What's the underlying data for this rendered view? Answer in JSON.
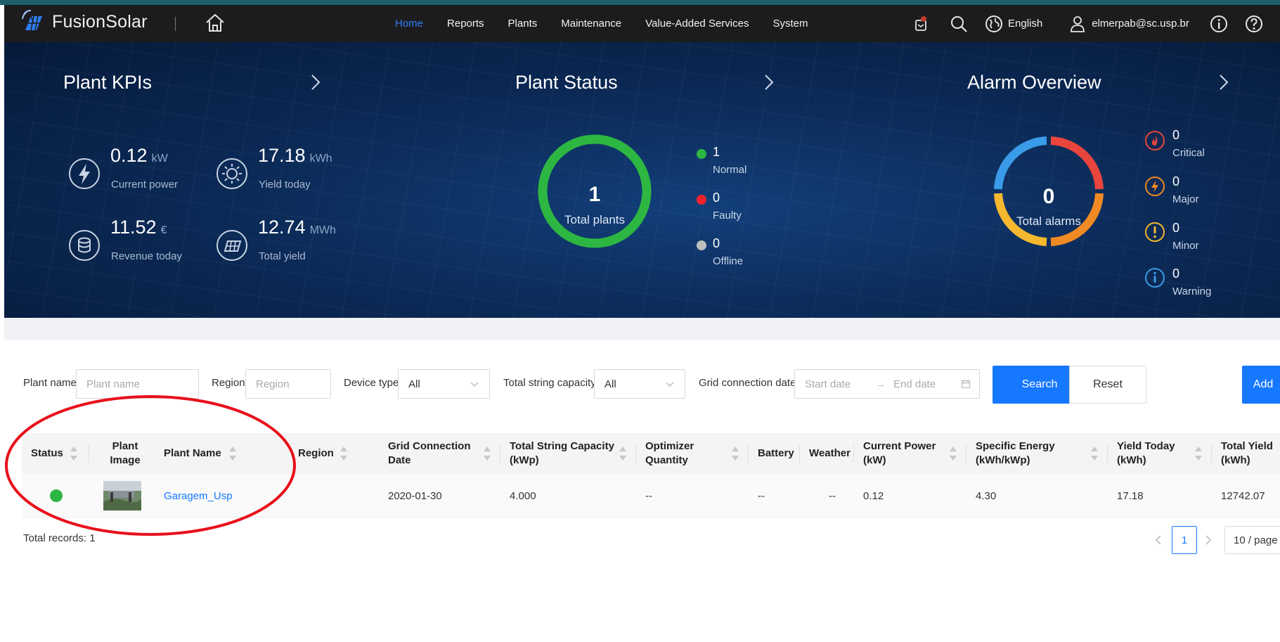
{
  "app": {
    "name": "FusionSolar"
  },
  "nav": {
    "items": [
      {
        "label": "Home",
        "active": true
      },
      {
        "label": "Reports"
      },
      {
        "label": "Plants"
      },
      {
        "label": "Maintenance"
      },
      {
        "label": "Value-Added Services"
      },
      {
        "label": "System"
      }
    ]
  },
  "header_tools": {
    "language": "English",
    "user": "elmerpab@sc.usp.br"
  },
  "kpis": {
    "title": "Plant KPIs",
    "current_power": {
      "value": "0.12",
      "unit": "kW",
      "label": "Current power"
    },
    "yield_today": {
      "value": "17.18",
      "unit": "kWh",
      "label": "Yield today"
    },
    "revenue_today": {
      "value": "11.52",
      "unit": "€",
      "label": "Revenue today"
    },
    "total_yield": {
      "value": "12.74",
      "unit": "MWh",
      "label": "Total yield"
    }
  },
  "plant_status": {
    "title": "Plant Status",
    "total": "1",
    "total_label": "Total plants",
    "normal": {
      "count": "1",
      "label": "Normal",
      "color": "#2db742"
    },
    "faulty": {
      "count": "0",
      "label": "Faulty",
      "color": "#f5222d"
    },
    "offline": {
      "count": "0",
      "label": "Offline",
      "color": "#bfbfbf"
    }
  },
  "alarms": {
    "title": "Alarm Overview",
    "total": "0",
    "total_label": "Total alarms",
    "critical": {
      "count": "0",
      "label": "Critical",
      "color": "#e8453c"
    },
    "major": {
      "count": "0",
      "label": "Major",
      "color": "#f08a24"
    },
    "minor": {
      "count": "0",
      "label": "Minor",
      "color": "#f5b82e"
    },
    "warning": {
      "count": "0",
      "label": "Warning",
      "color": "#3a9be8"
    }
  },
  "filters": {
    "plant_name_label": "Plant name",
    "plant_name_placeholder": "Plant name",
    "region_label": "Region",
    "region_placeholder": "Region",
    "device_type_label": "Device type",
    "device_type_value": "All",
    "capacity_label": "Total string capacity",
    "capacity_value": "All",
    "grid_date_label": "Grid connection date",
    "start_placeholder": "Start date",
    "end_placeholder": "End date",
    "search_button": "Search",
    "reset_button": "Reset",
    "add_button": "Add"
  },
  "table": {
    "columns": {
      "status": "Status",
      "image": "Plant Image",
      "name": "Plant Name",
      "region": "Region",
      "grid_date": "Grid Connection Date",
      "capacity": "Total String Capacity (kWp)",
      "optimizer": "Optimizer Quantity",
      "battery": "Battery",
      "weather": "Weather",
      "current_power": "Current Power (kW)",
      "specific_energy": "Specific Energy (kWh/kWp)",
      "yield_today": "Yield Today (kWh)",
      "total_yield": "Total Yield (kWh)"
    },
    "rows": [
      {
        "status_color": "#2db742",
        "name": "Garagem_Usp",
        "region": "",
        "grid_date": "2020-01-30",
        "capacity": "4.000",
        "optimizer": "--",
        "battery": "--",
        "weather": "--",
        "current_power": "0.12",
        "specific_energy": "4.30",
        "yield_today": "17.18",
        "total_yield": "12742.07"
      }
    ],
    "total_records": "Total records: 1"
  },
  "pagination": {
    "current": "1",
    "page_size": "10 / page"
  }
}
